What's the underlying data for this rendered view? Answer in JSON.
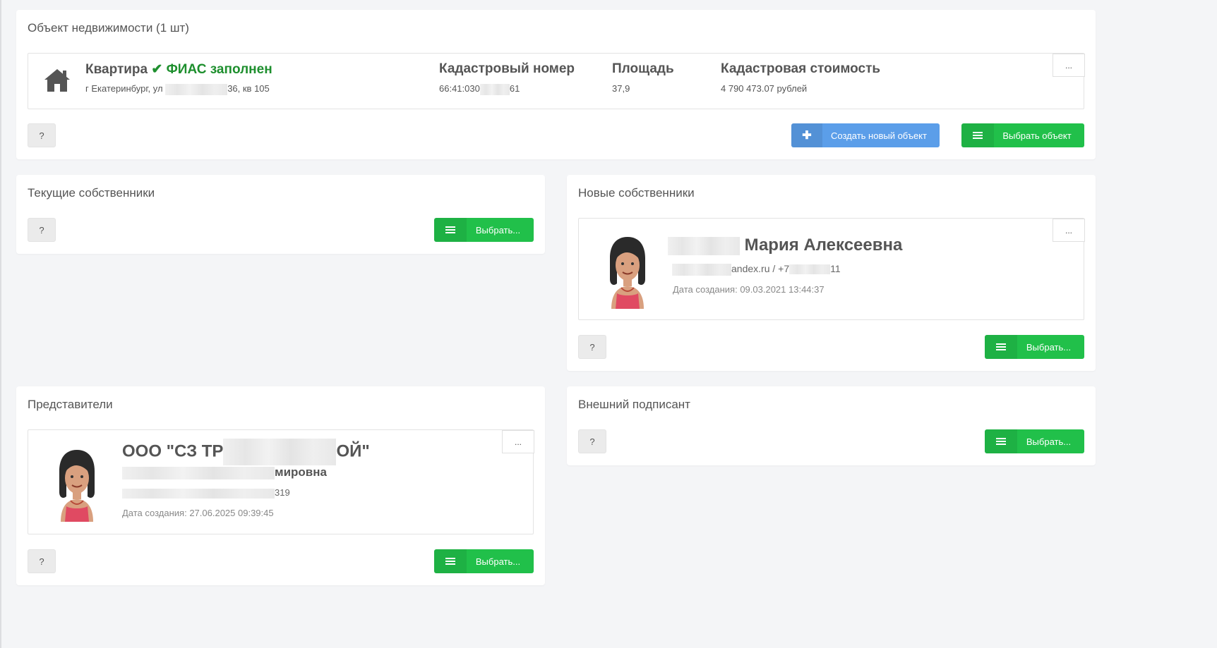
{
  "property_panel": {
    "title": "Объект недвижимости (1 шт)",
    "type_label": "Квартира",
    "fias_status": "ФИАС заполнен",
    "address_prefix": "г Екатеринбург, ул ",
    "address_suffix": "36, кв 105",
    "cadastral_label": "Кадастровый номер",
    "cadastral_prefix": "66:41:030",
    "cadastral_suffix": "61",
    "area_label": "Площадь",
    "area_value": "37,9",
    "cost_label": "Кадастровая стоимость",
    "cost_value": "4 790 473.07 рублей",
    "more_label": "...",
    "help_label": "?",
    "create_button": "Создать новый объект",
    "select_button": "Выбрать объект"
  },
  "current_owners": {
    "title": "Текущие собственники",
    "help_label": "?",
    "select_button": "Выбрать..."
  },
  "new_owners": {
    "title": "Новые собственники",
    "person_name": "Мария Алексеевна",
    "contact_middle": "andex.ru / +7",
    "contact_suffix": "11",
    "created": "Дата создания: 09.03.2021 13:44:37",
    "more_label": "...",
    "help_label": "?",
    "select_button": "Выбрать..."
  },
  "representatives": {
    "title": "Представители",
    "org_prefix": "ООО \"СЗ ТР",
    "org_suffix": "ОЙ\"",
    "person_suffix": "мировна",
    "contact_suffix": "319",
    "created": "Дата создания: 27.06.2025 09:39:45",
    "more_label": "...",
    "help_label": "?",
    "select_button": "Выбрать..."
  },
  "external_signer": {
    "title": "Внешний подписант",
    "help_label": "?",
    "select_button": "Выбрать..."
  },
  "colors": {
    "green": "#21c04a",
    "blue": "#5b9ee9",
    "fias_green": "#1e8f2e"
  }
}
